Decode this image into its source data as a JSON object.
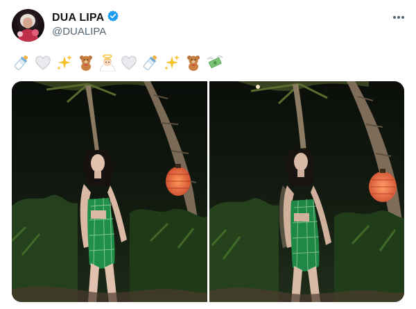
{
  "author": {
    "display_name": "DUA LIPA",
    "handle": "@DUALIPA",
    "verified": true,
    "verified_color": "#1d9bf0"
  },
  "menu": {
    "icon": "more-horizontal-icon"
  },
  "tweet": {
    "emoji": [
      {
        "icon": "baby-bottle-icon"
      },
      {
        "icon": "white-heart-icon"
      },
      {
        "icon": "sparkles-icon"
      },
      {
        "icon": "teddy-bear-icon"
      },
      {
        "icon": "angel-face-icon"
      },
      {
        "icon": "white-heart-icon"
      },
      {
        "icon": "baby-bottle-icon"
      },
      {
        "icon": "sparkles-icon"
      },
      {
        "icon": "teddy-bear-icon"
      },
      {
        "icon": "money-with-wings-icon"
      }
    ]
  },
  "media": {
    "count": 2,
    "photos": [
      {
        "subject": "woman-in-green-plaid-dress",
        "scene": "night-garden-with-palm-trees-and-lantern"
      },
      {
        "subject": "woman-in-green-plaid-dress-blurred",
        "scene": "night-garden-with-palm-trees-and-lantern"
      }
    ]
  },
  "colors": {
    "text_primary": "#0f1419",
    "text_secondary": "#536471",
    "plaid_green": "#1f8f4a",
    "lantern_orange": "#e8643a"
  }
}
